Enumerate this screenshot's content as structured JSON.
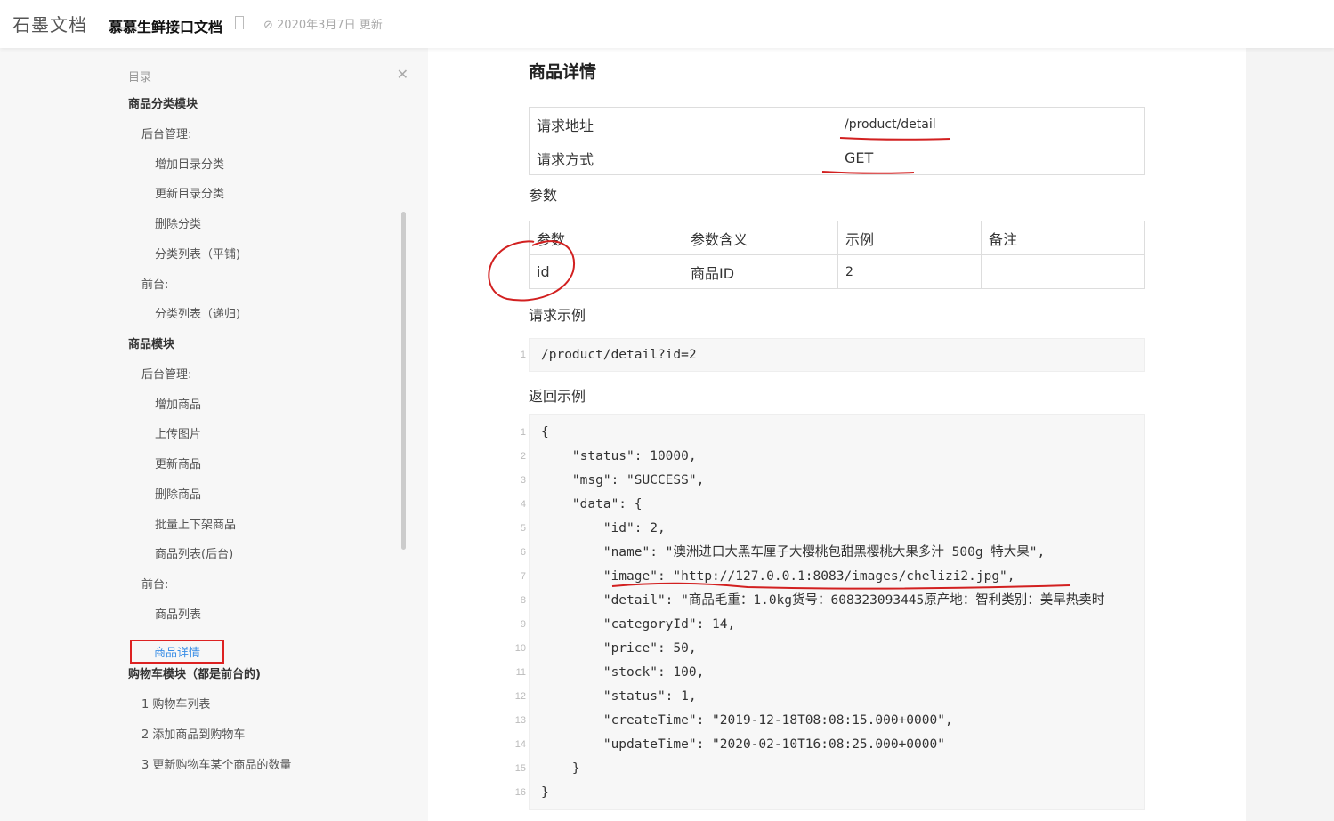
{
  "header": {
    "logo": "石墨文档",
    "doc_title": "慕慕生鲜接口文档",
    "updated": "2020年3月7日 更新"
  },
  "toc": {
    "title": "目录",
    "items": [
      {
        "label": "商品分类模块",
        "level": 1
      },
      {
        "label": "后台管理:",
        "level": 2
      },
      {
        "label": "增加目录分类",
        "level": 3
      },
      {
        "label": "更新目录分类",
        "level": 3
      },
      {
        "label": "删除分类",
        "level": 3
      },
      {
        "label": "分类列表（平铺)",
        "level": 3
      },
      {
        "label": "前台:",
        "level": 2
      },
      {
        "label": "分类列表（递归)",
        "level": 3
      },
      {
        "label": "商品模块",
        "level": 1
      },
      {
        "label": "后台管理:",
        "level": 2
      },
      {
        "label": "增加商品",
        "level": 3
      },
      {
        "label": "上传图片",
        "level": 3
      },
      {
        "label": "更新商品",
        "level": 3
      },
      {
        "label": "删除商品",
        "level": 3
      },
      {
        "label": "批量上下架商品",
        "level": 3
      },
      {
        "label": "商品列表(后台)",
        "level": 3
      },
      {
        "label": "前台:",
        "level": 2
      },
      {
        "label": "商品列表",
        "level": 3
      },
      {
        "label": "商品详情",
        "level": 3,
        "active": true
      },
      {
        "label": "购物车模块（都是前台的)",
        "level": 1
      },
      {
        "label": "1    购物车列表",
        "level": "num"
      },
      {
        "label": "2    添加商品到购物车",
        "level": "num"
      },
      {
        "label": "3    更新购物车某个商品的数量",
        "level": "num"
      }
    ]
  },
  "content": {
    "title": "商品详情",
    "info": [
      [
        "请求地址",
        "/product/detail"
      ],
      [
        "请求方式",
        "GET"
      ]
    ],
    "params_label": "参数",
    "params_headers": [
      "参数",
      "参数含义",
      "示例",
      "备注"
    ],
    "params_rows": [
      [
        "id",
        "商品ID",
        "2",
        ""
      ]
    ],
    "request_label": "请求示例",
    "request_code": [
      "/product/detail?id=2"
    ],
    "response_label": "返回示例",
    "response_code": [
      "{",
      "    \"status\": 10000,",
      "    \"msg\": \"SUCCESS\",",
      "    \"data\": {",
      "        \"id\": 2,",
      "        \"name\": \"澳洲进口大黑车厘子大樱桃包甜黑樱桃大果多汁 500g 特大果\",",
      "        \"image\": \"http://127.0.0.1:8083/images/chelizi2.jpg\",",
      "        \"detail\": \"商品毛重：1.0kg货号：608323093445原产地：智利类别：美早热卖时",
      "        \"categoryId\": 14,",
      "        \"price\": 50,",
      "        \"stock\": 100,",
      "        \"status\": 1,",
      "        \"createTime\": \"2019-12-18T08:08:15.000+0000\",",
      "        \"updateTime\": \"2020-02-10T16:08:25.000+0000\"",
      "    }",
      "}"
    ]
  },
  "colors": {
    "annotation": "#d22020",
    "active_link": "#3a8ee6"
  }
}
